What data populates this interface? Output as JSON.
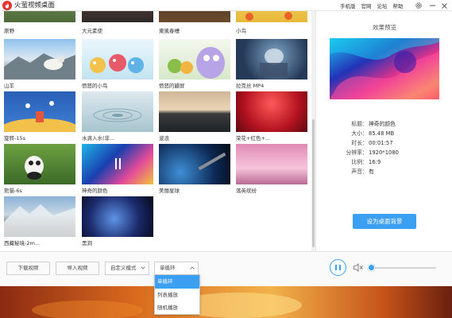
{
  "app": {
    "title": "火萤视频桌面"
  },
  "top_links": [
    "手机版",
    "官网",
    "论坛",
    "帮助"
  ],
  "colors": {
    "accent": "#3b9ff2",
    "logo": "#e8322d"
  },
  "videos": [
    {
      "title": "原野"
    },
    {
      "title": "大元素使"
    },
    {
      "title": "東風春槽"
    },
    {
      "title": "小鸟"
    },
    {
      "title": "山羊"
    },
    {
      "title": "愤怒的小鸟"
    },
    {
      "title": "愤怒的鼹屏"
    },
    {
      "title": "拉克丝 MP4"
    },
    {
      "title": "旋转-15s"
    },
    {
      "title": "水滴入水(非..."
    },
    {
      "title": "波浪"
    },
    {
      "title": "荣花+红色+..."
    },
    {
      "title": "熊猫-6s"
    },
    {
      "title": "神奇的颜色"
    },
    {
      "title": "美丽星球"
    },
    {
      "title": "落英缤纷"
    },
    {
      "title": "西藏秘境-2m..."
    },
    {
      "title": "黑洞"
    }
  ],
  "preview": {
    "title": "效果预览",
    "info": [
      {
        "key": "标题",
        "value": "神奇的颜色"
      },
      {
        "key": "大小",
        "value": "85.48 MB"
      },
      {
        "key": "时长",
        "value": "00:01:57"
      },
      {
        "key": "分辨率",
        "value": "1920*1080"
      },
      {
        "key": "比例",
        "value": "16:9"
      },
      {
        "key": "声音",
        "value": "有"
      }
    ],
    "set_bg_label": "设为桌面背景"
  },
  "toolbar": {
    "download_label": "下载视频",
    "import_label": "导入视频",
    "mode_value": "自定义模式",
    "loop_value": "单循环",
    "loop_options": [
      "单循环",
      "列表播放",
      "随机播放"
    ],
    "volume": 0.0
  }
}
